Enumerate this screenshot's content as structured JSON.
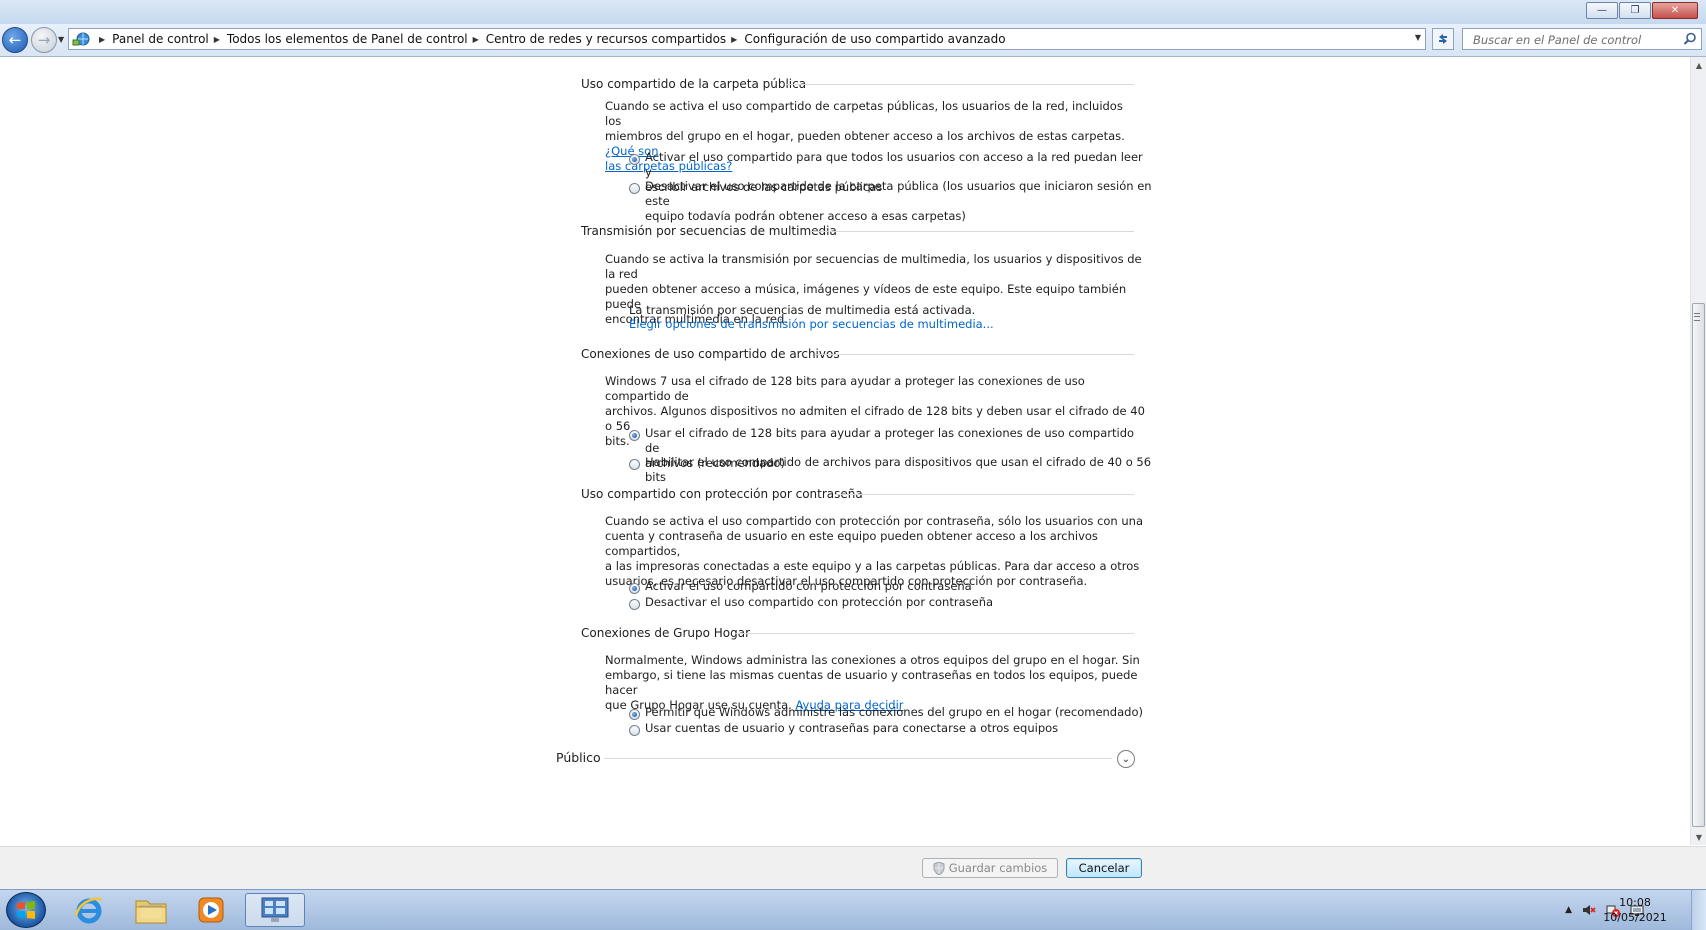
{
  "window": {
    "minimize_glyph": "—",
    "restore_glyph": "❐",
    "close_glyph": "✕"
  },
  "address_bar": {
    "breadcrumbs": [
      "Panel de control",
      "Todos los elementos de Panel de control",
      "Centro de redes y recursos compartidos",
      "Configuración de uso compartido avanzado"
    ],
    "search_placeholder": "Buscar en el Panel de control"
  },
  "sections": [
    {
      "title": "Uso compartido de la carpeta pública",
      "description_lines": [
        "Cuando se activa el uso compartido de carpetas públicas, los usuarios de la red, incluidos los",
        "miembros del grupo en el hogar, pueden obtener acceso a los archivos de estas carpetas."
      ],
      "help_link_part1": "¿Qué son",
      "help_link_part2": "las carpetas públicas?",
      "options": [
        {
          "lines": [
            "Activar el uso compartido para que todos los usuarios con acceso a la red puedan leer y",
            "escribir archivos de las carpetas públicas"
          ],
          "selected": true
        },
        {
          "lines": [
            "Desactivar el uso compartido de la carpeta pública (los usuarios que iniciaron sesión en este",
            "equipo todavía podrán obtener acceso a esas carpetas)"
          ],
          "selected": false
        }
      ]
    },
    {
      "title": "Transmisión por secuencias de multimedia",
      "description_lines": [
        "Cuando se activa la transmisión por secuencias de multimedia, los usuarios y dispositivos de la red",
        "pueden obtener acceso a música, imágenes y vídeos de este equipo. Este equipo también puede",
        "encontrar multimedia en la red."
      ],
      "status": "La transmisión por secuencias de multimedia está activada.",
      "action_link": "Elegir opciones de transmisión por secuencias de multimedia..."
    },
    {
      "title": "Conexiones de uso compartido de archivos",
      "description_lines": [
        "Windows 7 usa el cifrado de 128 bits para ayudar a proteger las conexiones de uso compartido de",
        "archivos. Algunos dispositivos no admiten el cifrado de 128 bits y deben usar el cifrado de 40 o 56",
        "bits."
      ],
      "options": [
        {
          "lines": [
            "Usar el cifrado de 128 bits para ayudar a proteger las conexiones de uso compartido de",
            "archivos (recomendado)"
          ],
          "selected": true
        },
        {
          "lines": [
            "Habilitar el uso compartido de archivos para dispositivos que usan el cifrado de 40 o 56 bits"
          ],
          "selected": false
        }
      ]
    },
    {
      "title": "Uso compartido con protección por contraseña",
      "description_lines": [
        "Cuando se activa el uso compartido con protección por contraseña, sólo los usuarios con una",
        "cuenta y contraseña de usuario en este equipo pueden obtener acceso a los archivos compartidos,",
        "a las impresoras conectadas a este equipo y a las carpetas públicas. Para dar acceso a otros",
        "usuarios, es necesario desactivar el uso compartido con protección por contraseña."
      ],
      "options": [
        {
          "lines": [
            "Activar el uso compartido con protección por contraseña"
          ],
          "selected": true
        },
        {
          "lines": [
            "Desactivar el uso compartido con protección por contraseña"
          ],
          "selected": false
        }
      ]
    },
    {
      "title": "Conexiones de Grupo Hogar",
      "description_lines": [
        "Normalmente, Windows administra las conexiones a otros equipos del grupo en el hogar. Sin",
        "embargo, si tiene las mismas cuentas de usuario y contraseñas en todos los equipos, puede hacer",
        "que Grupo Hogar use su cuenta."
      ],
      "help_link": "Ayuda para decidir",
      "options": [
        {
          "lines": [
            "Permitir que Windows administre las conexiones del grupo en el hogar (recomendado)"
          ],
          "selected": true
        },
        {
          "lines": [
            "Usar cuentas de usuario y contraseñas para conectarse a otros equipos"
          ],
          "selected": false
        }
      ]
    }
  ],
  "profile_header": {
    "title": "Público",
    "expand_glyph": "⌄"
  },
  "footer": {
    "save_label": "Guardar cambios",
    "cancel_label": "Cancelar"
  },
  "taskbar": {
    "items": [
      "start-button",
      "internet-explorer",
      "windows-explorer",
      "media-player",
      "control-panel"
    ],
    "clock_time": "10:08",
    "clock_date": "10/05/2021"
  },
  "colors": {
    "link": "#0066cc",
    "selection_accent": "#1d5ab4"
  }
}
